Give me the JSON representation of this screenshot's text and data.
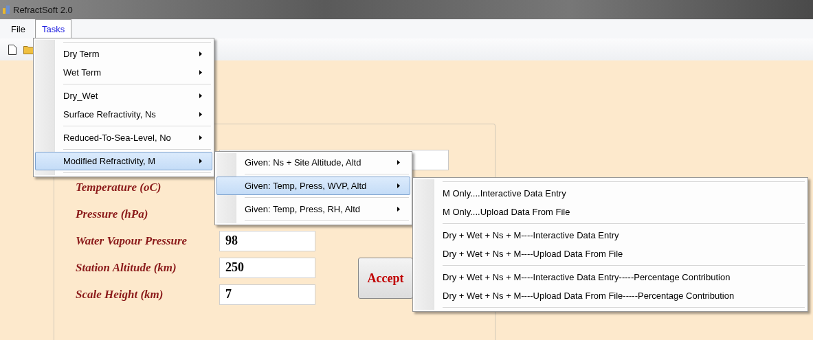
{
  "window": {
    "title": "RefractSoft 2.0"
  },
  "menubar": [
    {
      "label": "File",
      "selected": false
    },
    {
      "label": "Tasks",
      "selected": true
    }
  ],
  "tasks_menu": [
    {
      "kind": "separator"
    },
    {
      "kind": "item",
      "label": "Dry Term",
      "has_submenu": true,
      "selected": false
    },
    {
      "kind": "item",
      "label": "Wet Term",
      "has_submenu": true,
      "selected": false
    },
    {
      "kind": "separator"
    },
    {
      "kind": "item",
      "label": "Dry_Wet",
      "has_submenu": true,
      "selected": false
    },
    {
      "kind": "item",
      "label": "Surface Refractivity, Ns",
      "has_submenu": true,
      "selected": false
    },
    {
      "kind": "separator"
    },
    {
      "kind": "item",
      "label": "Reduced-To-Sea-Level, No",
      "has_submenu": true,
      "selected": false
    },
    {
      "kind": "separator"
    },
    {
      "kind": "item",
      "label": "Modified Refractivity, M",
      "has_submenu": true,
      "selected": true
    },
    {
      "kind": "separator"
    }
  ],
  "submenu": [
    {
      "kind": "item",
      "label": "Given:  Ns + Site Altitude, Altd",
      "has_submenu": true,
      "selected": false
    },
    {
      "kind": "separator"
    },
    {
      "kind": "item",
      "label": "Given:  Temp, Press, WVP, Altd",
      "has_submenu": true,
      "selected": true
    },
    {
      "kind": "separator"
    },
    {
      "kind": "item",
      "label": "Given: Temp, Press, RH, Altd",
      "has_submenu": true,
      "selected": false
    },
    {
      "kind": "separator"
    }
  ],
  "sub_submenu": [
    {
      "kind": "separator"
    },
    {
      "kind": "item",
      "label": "M Only....Interactive Data Entry",
      "has_submenu": false,
      "selected": false
    },
    {
      "kind": "item",
      "label": "M Only....Upload Data From File",
      "has_submenu": false,
      "selected": false
    },
    {
      "kind": "separator"
    },
    {
      "kind": "item",
      "label": "Dry + Wet + Ns + M----Interactive Data Entry",
      "has_submenu": false,
      "selected": false
    },
    {
      "kind": "item",
      "label": "Dry + Wet + Ns + M----Upload Data From File",
      "has_submenu": false,
      "selected": false
    },
    {
      "kind": "separator"
    },
    {
      "kind": "item",
      "label": "Dry + Wet + Ns + M----Interactive Data Entry-----Percentage Contribution",
      "has_submenu": false,
      "selected": false
    },
    {
      "kind": "item",
      "label": "Dry + Wet + Ns + M----Upload Data From File-----Percentage Contribution",
      "has_submenu": false,
      "selected": false
    },
    {
      "kind": "separator"
    }
  ],
  "form": {
    "rows": [
      {
        "label": "Temperature (oC)"
      },
      {
        "label": "Pressure (hPa)"
      },
      {
        "label": "Water Vapour Pressure",
        "value": "98"
      },
      {
        "label": "Station Altitude (km)",
        "value": "250"
      },
      {
        "label": "Scale Height (km)",
        "value": "7"
      }
    ],
    "accept_button": "Accept"
  }
}
